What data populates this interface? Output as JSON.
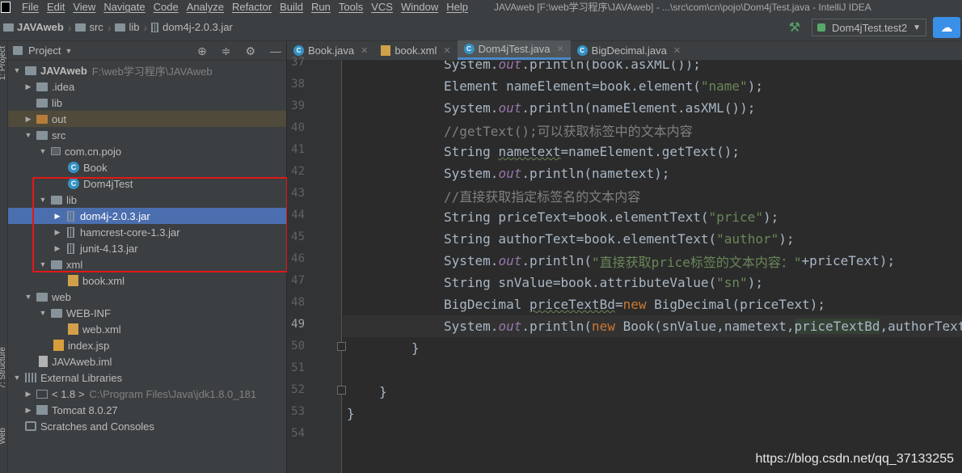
{
  "menubar": {
    "items": [
      "File",
      "Edit",
      "View",
      "Navigate",
      "Code",
      "Analyze",
      "Refactor",
      "Build",
      "Run",
      "Tools",
      "VCS",
      "Window",
      "Help"
    ],
    "window_title": "JAVAweb [F:\\web学习程序\\JAVAweb] - ...\\src\\com\\cn\\pojo\\Dom4jTest.java - IntelliJ IDEA"
  },
  "navbar": {
    "crumbs": [
      "JAVAweb",
      "src",
      "lib",
      "dom4j-2.0.3.jar"
    ],
    "run_config": "Dom4jTest.test2"
  },
  "left_strip": {
    "tabs": [
      "1: Project",
      "7: Structure",
      "Web"
    ]
  },
  "project_panel": {
    "title": "Project",
    "tree": [
      {
        "label": "JAVAweb",
        "path": "F:\\web学习程序\\JAVAweb"
      },
      {
        "label": ".idea"
      },
      {
        "label": "lib"
      },
      {
        "label": "out"
      },
      {
        "label": "src"
      },
      {
        "label": "com.cn.pojo"
      },
      {
        "label": "Book"
      },
      {
        "label": "Dom4jTest"
      },
      {
        "label": "lib"
      },
      {
        "label": "dom4j-2.0.3.jar"
      },
      {
        "label": "hamcrest-core-1.3.jar"
      },
      {
        "label": "junit-4.13.jar"
      },
      {
        "label": "xml"
      },
      {
        "label": "book.xml"
      },
      {
        "label": "web"
      },
      {
        "label": "WEB-INF"
      },
      {
        "label": "web.xml"
      },
      {
        "label": "index.jsp"
      },
      {
        "label": "JAVAweb.iml"
      },
      {
        "label": "External Libraries"
      },
      {
        "label": "< 1.8 >",
        "path": "C:\\Program Files\\Java\\jdk1.8.0_181"
      },
      {
        "label": "Tomcat 8.0.27"
      },
      {
        "label": "Scratches and Consoles"
      }
    ]
  },
  "editor": {
    "tabs": [
      {
        "label": "Book.java"
      },
      {
        "label": "book.xml"
      },
      {
        "label": "Dom4jTest.java"
      },
      {
        "label": "BigDecimal.java"
      }
    ],
    "line_numbers": [
      "37",
      "38",
      "39",
      "40",
      "41",
      "42",
      "43",
      "44",
      "45",
      "46",
      "47",
      "48",
      "49",
      "50",
      "51",
      "52",
      "53",
      "54"
    ],
    "code": {
      "l37": [
        "System.",
        "out",
        ".println(book.asXML());"
      ],
      "l38": [
        "Element nameElement=book.element(",
        "\"name\"",
        ");"
      ],
      "l39": [
        "System.",
        "out",
        ".println(nameElement.asXML());"
      ],
      "l40": [
        "//getText();可以获取标签中的文本内容"
      ],
      "l41": [
        "String ",
        "nametext",
        "=nameElement.getText();"
      ],
      "l42": [
        "System.",
        "out",
        ".println(nametext);"
      ],
      "l43": [
        "//直接获取指定标签名的文本内容"
      ],
      "l44": [
        "String priceText=book.elementText(",
        "\"price\"",
        ");"
      ],
      "l45": [
        "String authorText=book.elementText(",
        "\"author\"",
        ");"
      ],
      "l46": [
        "System.",
        "out",
        ".println(",
        "\"直接获取price标签的文本内容：\"",
        "+priceText);"
      ],
      "l47": [
        "String snValue=book.attributeValue(",
        "\"sn\"",
        ");"
      ],
      "l48": [
        "BigDecimal ",
        "priceTextBd",
        "=",
        "new",
        " BigDecimal(priceText);"
      ],
      "l49": [
        "System.",
        "out",
        ".println(",
        "new",
        " Book(snValue,nametext,",
        "priceTextBd",
        ",authorText"
      ],
      "l50": [
        "}"
      ],
      "l52": [
        "}"
      ],
      "l53": [
        "}"
      ]
    }
  },
  "watermark": "https://blog.csdn.net/qq_37133255"
}
